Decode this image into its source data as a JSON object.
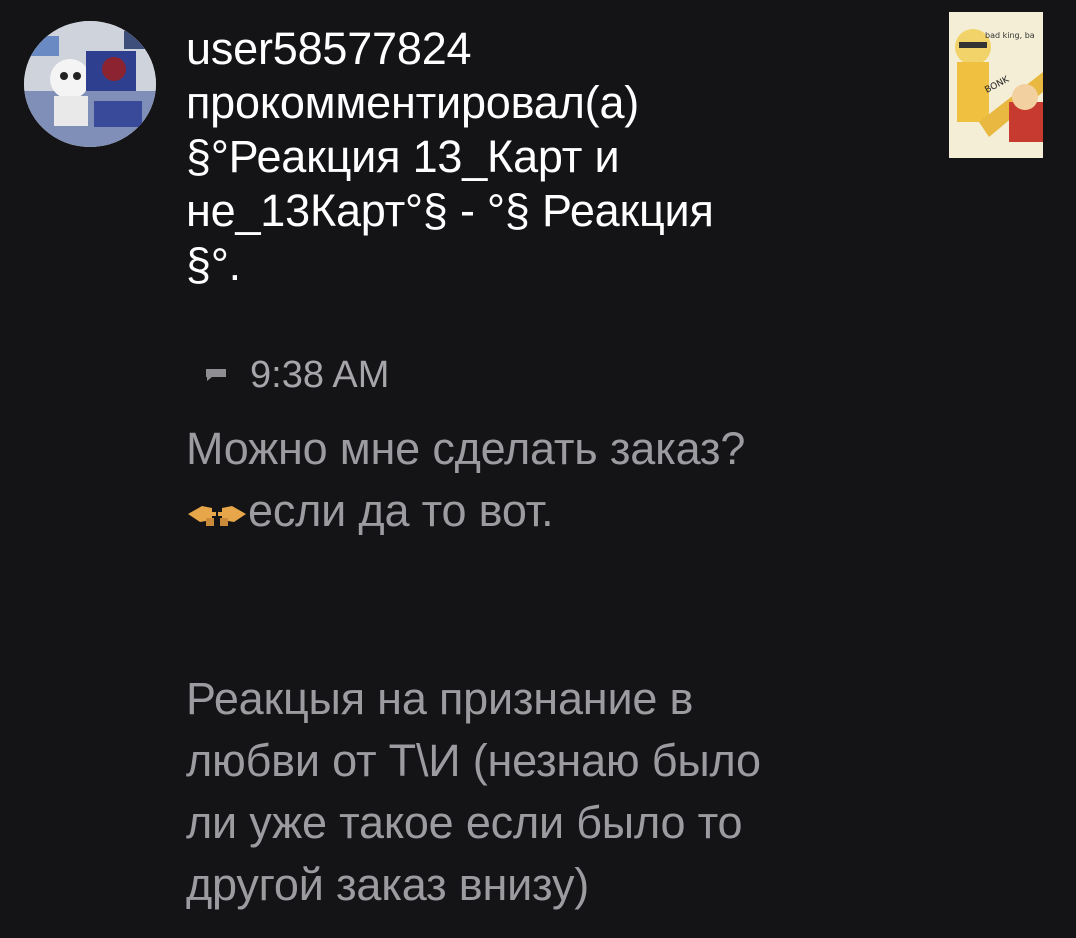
{
  "notification": {
    "avatar_icon": "user-avatar",
    "thumbnail_icon": "post-thumbnail",
    "header_lines": [
      "user58577824",
      "прокомментировал(а)",
      "§°Реакция 13_Карт и",
      "не_13Карт°§ - °§ Реакция",
      "§°."
    ],
    "comment_icon": "comment-icon",
    "time": "9:38 AM",
    "message_lines": [
      "Можно мне сделать заказ?",
      "если да то вот."
    ],
    "hand_emojis": [
      "left-pointing-hand",
      "right-pointing-hand"
    ],
    "request_lines": [
      "Реакцыя на признание в",
      "любви от Т\\И (незнаю было",
      "ли уже такое если было то",
      "другой заказ внизу)"
    ]
  },
  "colors": {
    "background": "#141316",
    "header_text": "#ffffff",
    "body_text": "#9c9ca0",
    "time_text": "#a6a6aa"
  }
}
